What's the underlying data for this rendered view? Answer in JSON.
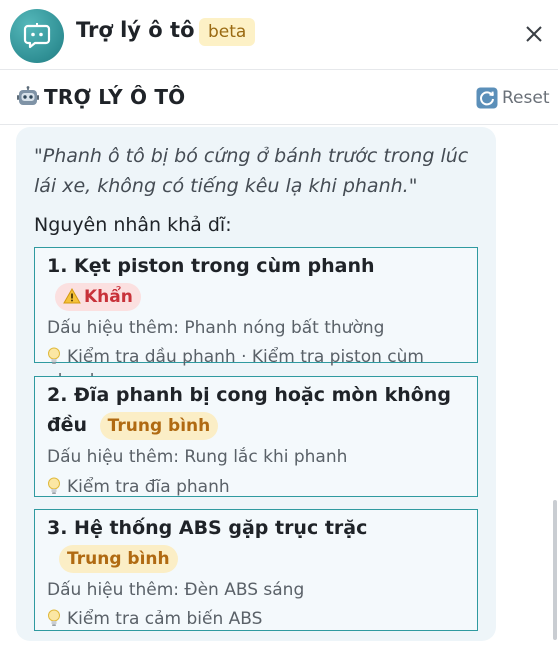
{
  "header": {
    "title": "Trợ lý ô tô",
    "badge": "beta",
    "avatar_icon": "chat-bot-icon",
    "close_icon": "close-icon"
  },
  "subbar": {
    "icon": "robot-icon",
    "title": "TRỢ LÝ Ô TÔ",
    "reset_icon": "refresh-icon",
    "reset_label": "Reset"
  },
  "main": {
    "quote": "\"Phanh ô tô bị bó cứng ở bánh trước trong lúc lái xe, không có tiếng kêu lạ khi phanh.\"",
    "causes_heading": "Nguyên nhân khả dĩ:",
    "causes": [
      {
        "title": "1. Kẹt piston trong cùm phanh",
        "tag_icon": "warning-icon",
        "tag": "Khẩn",
        "sign": "Dấu hiệu thêm: Phanh nóng bất thường",
        "check": "Kiểm tra dầu phanh · Kiểm tra piston cùm phanh"
      },
      {
        "title": "2. Đĩa phanh bị cong hoặc mòn không đều",
        "tag": "Trung bình",
        "sign": "Dấu hiệu thêm: Rung lắc khi phanh",
        "check": "Kiểm tra đĩa phanh"
      },
      {
        "title": "3. Hệ thống ABS gặp trục trặc",
        "tag": "Trung bình",
        "sign": "Dấu hiệu thêm: Đèn ABS sáng",
        "check": "Kiểm tra cảm biến ABS"
      }
    ]
  },
  "colors": {
    "accent": "#2f9aa0",
    "urgent": "#c8323a",
    "medium": "#b06a12",
    "badge_bg": "#fdf1c6"
  }
}
